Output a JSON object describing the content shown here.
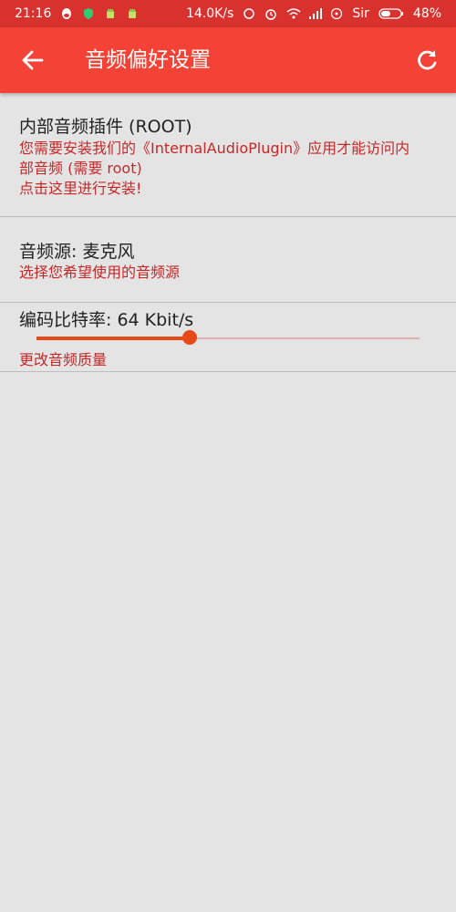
{
  "status_bar": {
    "time": "21:16",
    "net_speed": "14.0K/s",
    "carrier": "Sir",
    "battery": "48%",
    "icons": [
      "qq-icon",
      "shield-icon",
      "android-icon",
      "android-icon",
      "alarm-icon",
      "clock-icon",
      "wifi-icon",
      "signal-icon",
      "radiation-icon",
      "battery-icon"
    ]
  },
  "toolbar": {
    "title": "音频偏好设置",
    "back_icon": "arrow-left-icon",
    "refresh_icon": "refresh-icon"
  },
  "prefs": {
    "internal_plugin": {
      "title": "内部音频插件 (ROOT)",
      "summary": "您需要安装我们的《InternalAudioPlugin》应用才能访问内部音频 (需要 root)\n点击这里进行安装!"
    },
    "audio_source": {
      "title": "音频源: 麦克风",
      "summary": "选择您希望使用的音频源"
    },
    "bitrate": {
      "title": "编码比特率: 64 Kbit/s",
      "summary": "更改音频质量",
      "slider_value": 0.4
    }
  },
  "colors": {
    "status_bar": "#d9322e",
    "toolbar": "#f44336",
    "accent": "#e64a19",
    "summary_text": "#c62828",
    "background": "#e4e4e4"
  }
}
